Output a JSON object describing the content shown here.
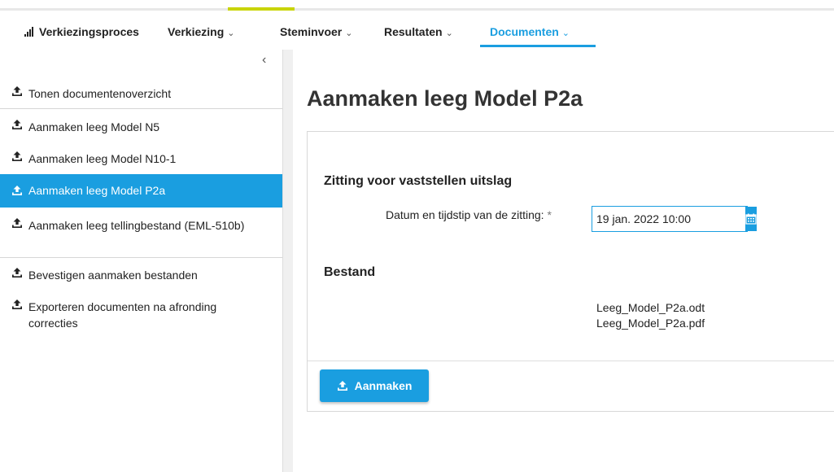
{
  "navbar": {
    "brand": "Verkiezingsproces",
    "items": [
      {
        "label": "Verkiezing"
      },
      {
        "label": "Steminvoer"
      },
      {
        "label": "Resultaten"
      },
      {
        "label": "Documenten"
      }
    ],
    "active": "Documenten",
    "chevron": "⌄"
  },
  "sidebar": {
    "collapse_glyph": "‹",
    "items": [
      {
        "label": "Tonen documentenoverzicht"
      },
      {
        "label": "Aanmaken leeg Model N5"
      },
      {
        "label": "Aanmaken leeg Model N10-1"
      },
      {
        "label": "Aanmaken leeg Model P2a",
        "active": true
      },
      {
        "label": "Aanmaken leeg tellingbestand (EML-510b)"
      },
      {
        "label": "Bevestigen aanmaken bestanden"
      },
      {
        "label": "Exporteren documenten na afronding correcties"
      }
    ]
  },
  "main": {
    "title": "Aanmaken leeg Model P2a",
    "section_session": "Zitting voor vaststellen uitslag",
    "date_label": "Datum en tijdstip van de zitting:",
    "required_mark": "*",
    "date_value": "19 jan. 2022 10:00",
    "section_file": "Bestand",
    "files": [
      "Leeg_Model_P2a.odt",
      "Leeg_Model_P2a.pdf"
    ],
    "create_button": "Aanmaken"
  },
  "colors": {
    "accent": "#1a9ee0",
    "top_accent": "#c8d400"
  },
  "icons": {
    "sidebar_item": "upload-icon",
    "date": "calendar-icon",
    "button": "upload-icon"
  }
}
